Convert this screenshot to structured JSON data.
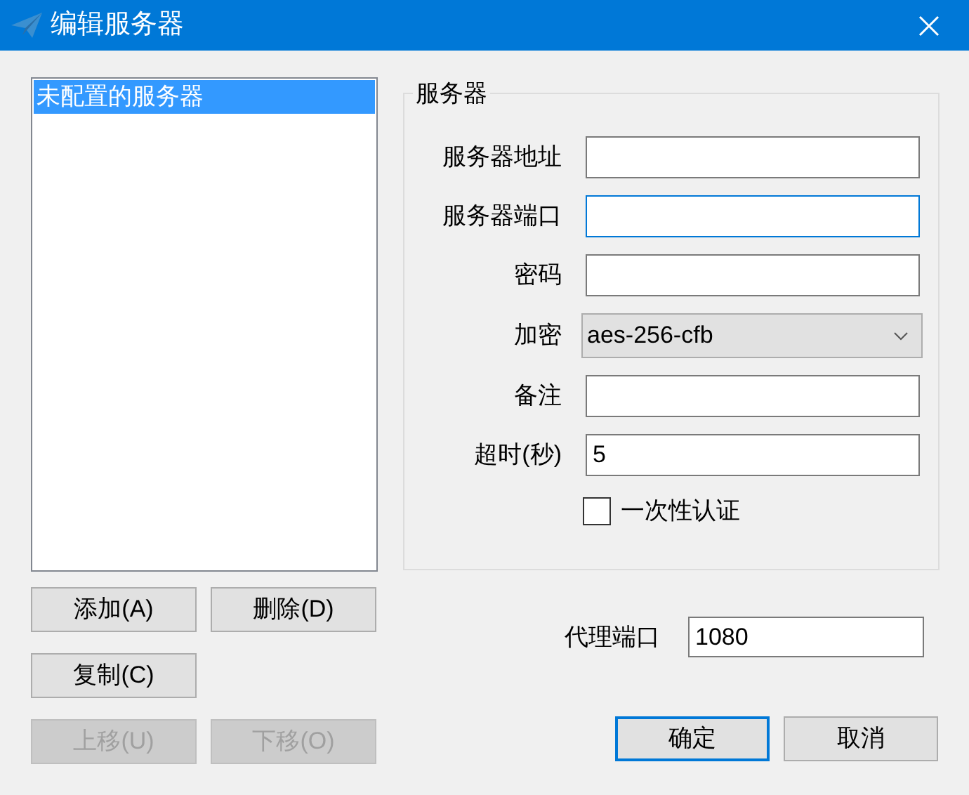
{
  "window": {
    "title": "编辑服务器"
  },
  "server_list": {
    "items": [
      {
        "label": "未配置的服务器",
        "selected": true
      }
    ]
  },
  "list_buttons": [
    {
      "label": "添加(A)",
      "disabled": false
    },
    {
      "label": "删除(D)",
      "disabled": false
    },
    {
      "label": "复制(C)",
      "disabled": false
    },
    {
      "label": "上移(U)",
      "disabled": true
    },
    {
      "label": "下移(O)",
      "disabled": true
    }
  ],
  "server_group": {
    "title": "服务器",
    "fields": [
      {
        "label": "服务器地址",
        "kind": "text",
        "focused": false
      },
      {
        "label": "服务器端口",
        "kind": "text",
        "focused": true
      },
      {
        "label": "密码",
        "kind": "text",
        "focused": false
      },
      {
        "label": "加密",
        "kind": "select",
        "value": "aes-256-cfb",
        "focused": false
      },
      {
        "label": "备注",
        "kind": "text",
        "focused": false
      },
      {
        "label": "超时(秒)",
        "kind": "text",
        "value": "5",
        "focused": false
      }
    ],
    "checkbox": {
      "label": "一次性认证",
      "checked": false
    }
  },
  "proxy_port": {
    "label": "代理端口",
    "value": "1080"
  },
  "dialog_buttons": [
    {
      "label": "确定",
      "default": true
    },
    {
      "label": "取消",
      "default": false
    }
  ]
}
